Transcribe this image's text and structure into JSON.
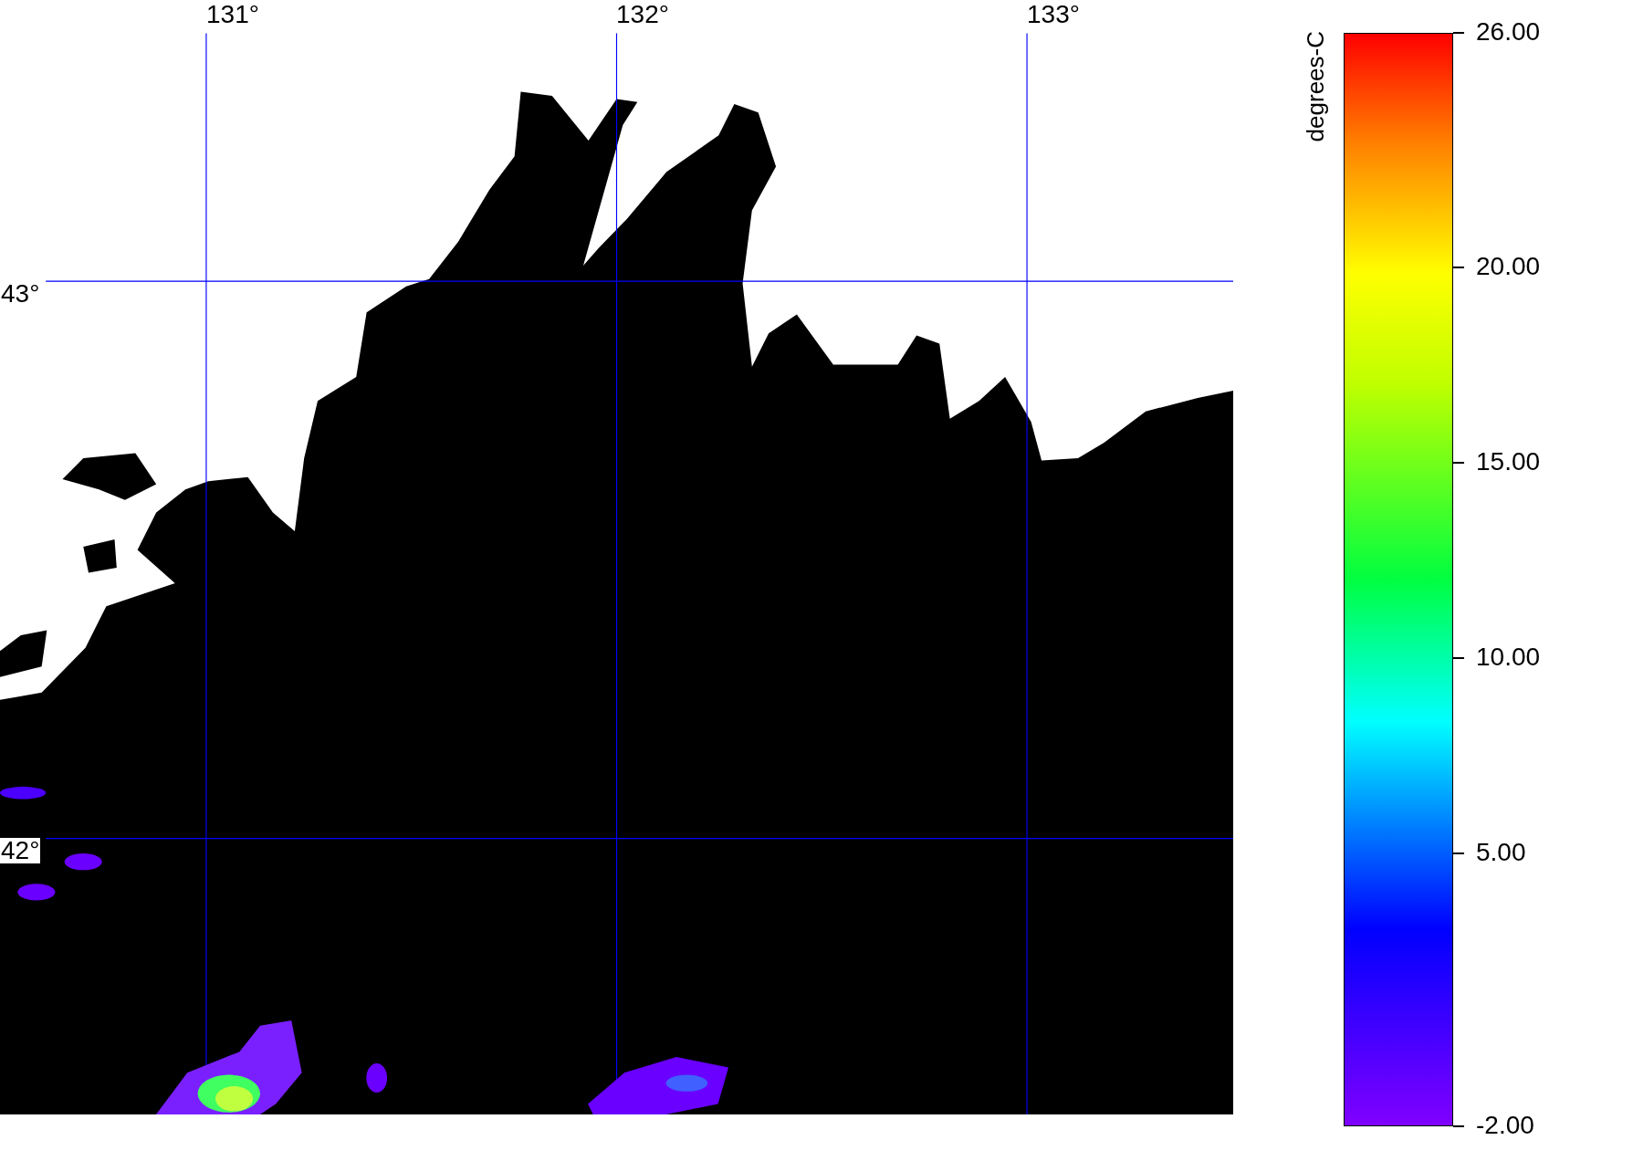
{
  "map": {
    "longitude_labels": [
      "131°",
      "132°",
      "133°"
    ],
    "latitude_labels": [
      "43°",
      "42°"
    ]
  },
  "colorbar": {
    "label": "degrees-C",
    "ticks": [
      "26.00",
      "20.00",
      "15.00",
      "10.00",
      "5.00",
      "-2.00"
    ]
  }
}
